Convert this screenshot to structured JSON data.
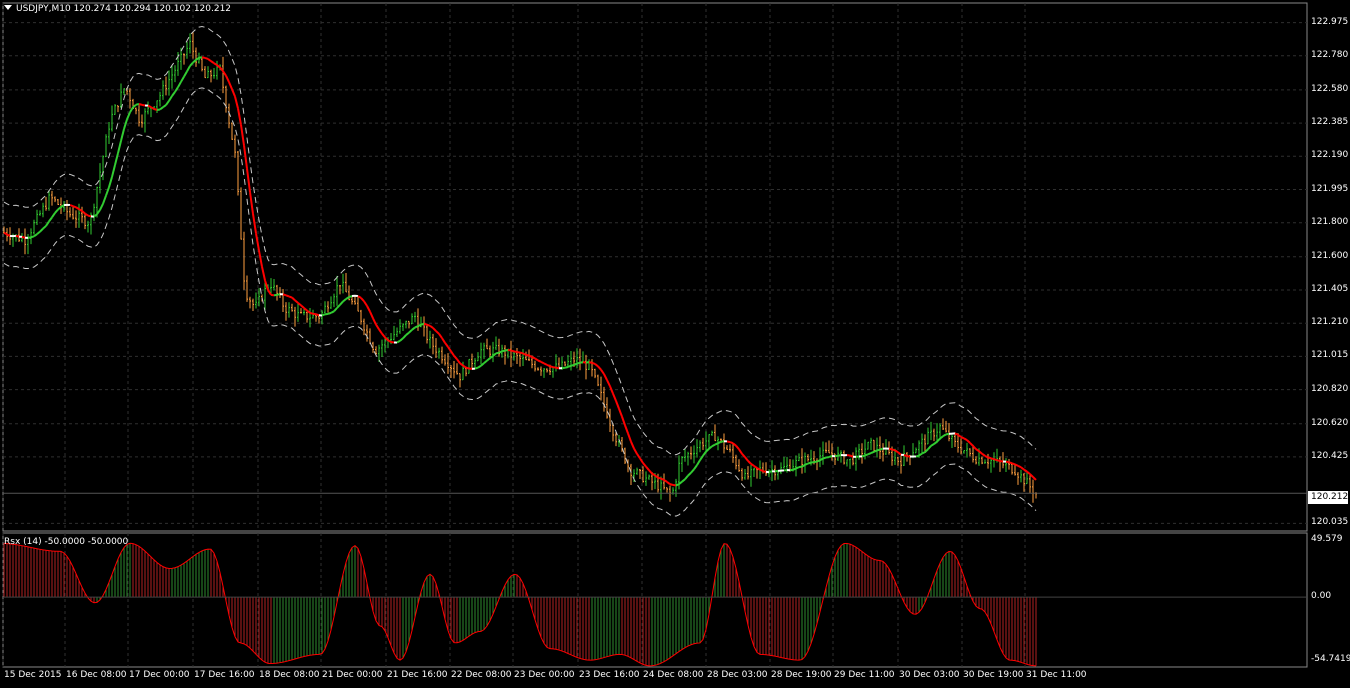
{
  "window": {
    "symbol_title": "USDJPY,M10",
    "ohlc": "120.274 120.294 120.102 120.212",
    "bid": "120.212"
  },
  "price_axis": {
    "ticks": [
      "122.975",
      "122.780",
      "122.580",
      "122.385",
      "122.190",
      "121.995",
      "121.800",
      "121.600",
      "121.405",
      "121.210",
      "121.015",
      "120.820",
      "120.620",
      "120.425",
      "120.035"
    ],
    "range": [
      120.0,
      123.1
    ]
  },
  "time_axis": {
    "ticks": [
      "15 Dec 2015",
      "16 Dec 08:00",
      "17 Dec 00:00",
      "17 Dec 16:00",
      "18 Dec 08:00",
      "21 Dec 00:00",
      "21 Dec 16:00",
      "22 Dec 08:00",
      "23 Dec 00:00",
      "23 Dec 16:00",
      "24 Dec 08:00",
      "28 Dec 03:00",
      "28 Dec 19:00",
      "29 Dec 11:00",
      "30 Dec 03:00",
      "30 Dec 19:00",
      "31 Dec 11:00"
    ]
  },
  "indicator": {
    "title": "Rsx (14) -50.0000 -50.0000",
    "ticks": [
      "49.579",
      "0.00",
      "-54.7419"
    ]
  },
  "colors": {
    "background": "#000000",
    "grid": "#2f2f2f",
    "bull_bar": "#32cd32",
    "bear_bar": "#ffa040",
    "ma_up": "#32cd32",
    "ma_down": "#ff0000",
    "ma_flat": "#ffffff",
    "band": "#c8c8c8",
    "rsx_line": "#ff0000",
    "rsx_hist_up": "#2e8b2e",
    "rsx_hist_down": "#b22222"
  }
}
